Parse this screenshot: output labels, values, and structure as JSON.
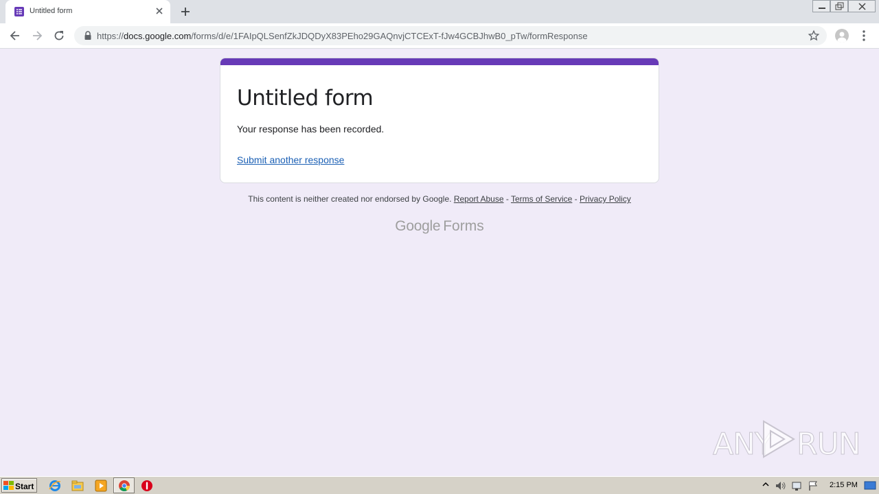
{
  "browser": {
    "tab_title": "Untitled form",
    "url_scheme": "https://",
    "url_host": "docs.google.com",
    "url_path": "/forms/d/e/1FAIpQLSenfZkJDQDyX83PEho29GAQnvjCTCExT-fJw4GCBJhwB0_pTw/formResponse"
  },
  "form": {
    "title": "Untitled form",
    "confirmation": "Your response has been recorded.",
    "submit_another": "Submit another response",
    "accent_color": "#673ab7"
  },
  "footer": {
    "disclaimer": "This content is neither created nor endorsed by Google.",
    "report_abuse": "Report Abuse",
    "separator": " - ",
    "terms": "Terms of Service",
    "privacy": "Privacy Policy",
    "brand_google": "Google",
    "brand_forms": "Forms"
  },
  "watermark": {
    "left": "ANY",
    "right": "RUN"
  },
  "taskbar": {
    "start_label": "Start",
    "clock": "2:15 PM",
    "icons": [
      "internet-explorer-icon",
      "file-explorer-icon",
      "media-player-icon",
      "chrome-icon",
      "stop-icon"
    ]
  }
}
